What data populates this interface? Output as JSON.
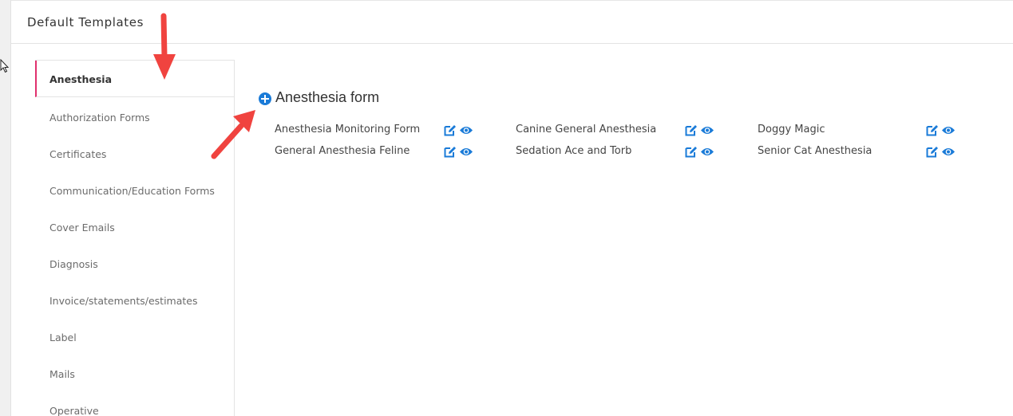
{
  "header": {
    "title": "Default Templates"
  },
  "sidebar": {
    "items": [
      {
        "label": "Anesthesia",
        "active": true
      },
      {
        "label": "Authorization Forms"
      },
      {
        "label": "Certificates"
      },
      {
        "label": "Communication/Education Forms"
      },
      {
        "label": "Cover Emails"
      },
      {
        "label": "Diagnosis"
      },
      {
        "label": "Invoice/statements/estimates"
      },
      {
        "label": "Label"
      },
      {
        "label": "Mails"
      },
      {
        "label": "Operative"
      }
    ]
  },
  "main": {
    "section_title": "Anesthesia form",
    "forms": [
      {
        "name": "Anesthesia Monitoring Form"
      },
      {
        "name": "Canine General Anesthesia"
      },
      {
        "name": "Doggy Magic"
      },
      {
        "name": "General Anesthesia Feline"
      },
      {
        "name": "Sedation Ace and Torb"
      },
      {
        "name": "Senior Cat Anesthesia"
      }
    ]
  },
  "colors": {
    "accent": "#1a7bd8",
    "active_border": "#e0306d",
    "annotation_arrow": "#f0433f"
  },
  "icons": {
    "add": "plus-circle-icon",
    "edit": "edit-icon",
    "view": "eye-icon"
  }
}
